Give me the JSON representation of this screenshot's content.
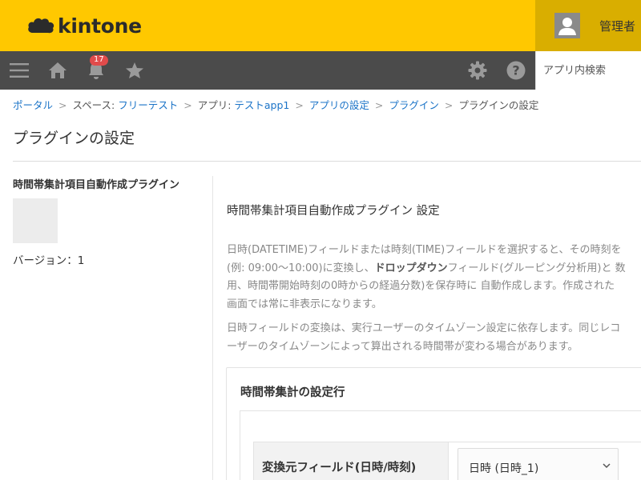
{
  "header": {
    "app_name": "kintone",
    "user_name": "管理者"
  },
  "navbar": {
    "icons": [
      "menu-icon",
      "home-icon",
      "bell-icon",
      "star-icon",
      "gear-icon",
      "help-icon"
    ],
    "notification_count": "17",
    "search_placeholder": "アプリ内検索"
  },
  "breadcrumb": {
    "portal": "ポータル",
    "space_prefix": "スペース: ",
    "space": "フリーテスト",
    "app_prefix": "アプリ: ",
    "app": "テストapp1",
    "app_settings": "アプリの設定",
    "plugin": "プラグイン",
    "current": "プラグインの設定",
    "separator": ">"
  },
  "page": {
    "title": "プラグインの設定"
  },
  "plugin": {
    "name": "時間帯集計項目自動作成プラグイン",
    "version": "バージョン：1"
  },
  "settings": {
    "title": "時間帯集計項目自動作成プラグイン 設定",
    "desc1_line1": "日時(DATETIME)フィールドまたは時刻(TIME)フィールドを選択すると、その時刻を",
    "desc1_line2_a": "(例: 09:00〜10:00)に変換し、",
    "desc1_line2_bold": "ドロップダウン",
    "desc1_line2_b": "フィールド(グルーピング分析用)と 数",
    "desc1_line3": "用、時間帯開始時刻の0時からの経過分数)を保存時に 自動作成します。作成された",
    "desc1_line4": "画面では常に非表示になります。",
    "desc2_line1": "日時フィールドの変換は、実行ユーザーのタイムゾーン設定に依存します。同じレコ",
    "desc2_line2": "ーザーのタイムゾーンによって算出される時間帯が変わる場合があります。",
    "panel_title": "時間帯集計の設定行",
    "row_label": "変換元フィールド(日時/時刻)",
    "row_select_value": "日時 (日時_1)"
  },
  "colors": {
    "header_bg": "#ffc800",
    "user_area_bg": "#d9ae00",
    "navbar_bg": "#4b4b4b",
    "link": "#1a73c7",
    "badge": "#e14b4b"
  }
}
